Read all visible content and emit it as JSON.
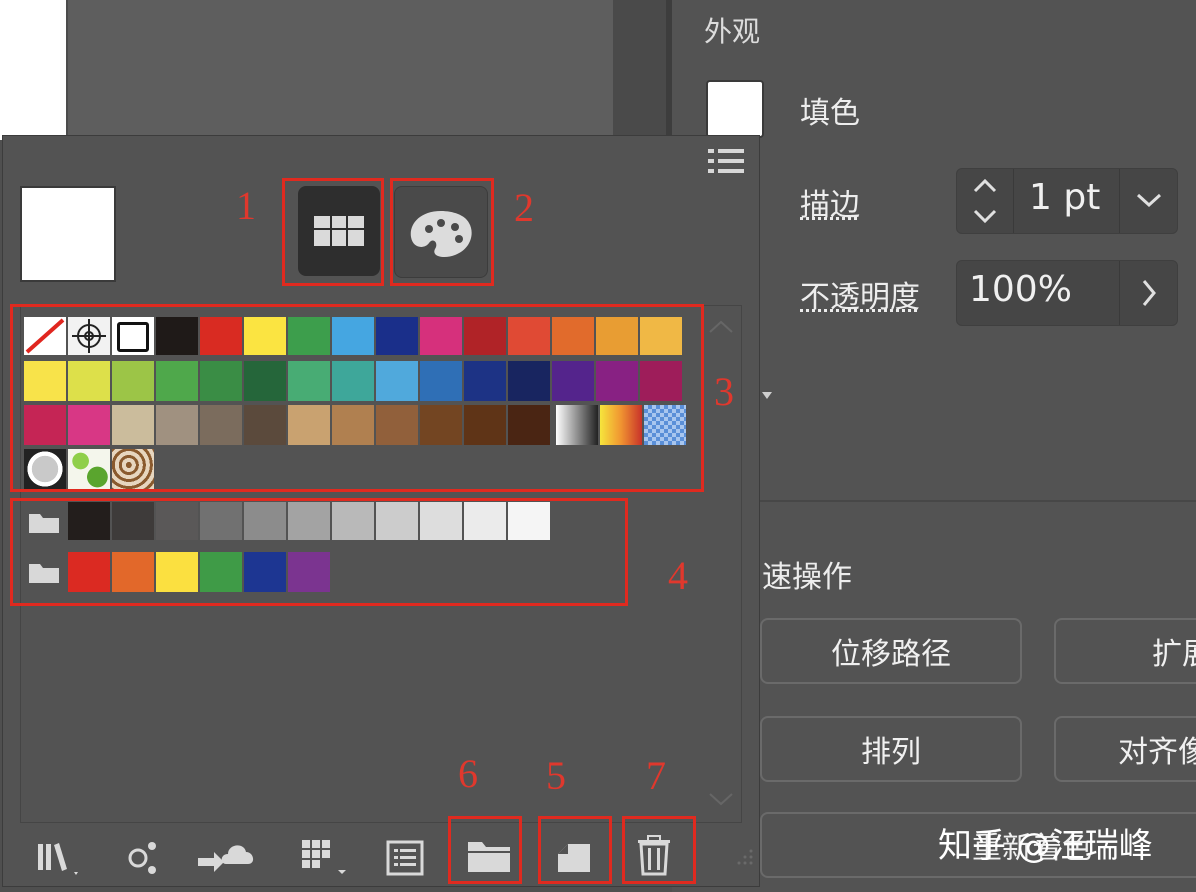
{
  "appearance_panel": {
    "title": "外观",
    "fill_label": "填色",
    "stroke_label": "描边",
    "stroke_value": "1 pt",
    "opacity_label": "不透明度",
    "opacity_value": "100%"
  },
  "quick_actions": {
    "title": "快速操作",
    "title_visible": "速操作",
    "offset_path": "位移路径",
    "expand": "扩展",
    "arrange": "排列",
    "align": "对齐像",
    "recolor": "重新着色"
  },
  "annotations": [
    "1",
    "2",
    "3",
    "4",
    "5",
    "6",
    "7"
  ],
  "watermark": "知乎 @汪瑞峰",
  "swatch_colors": {
    "row1": [
      "#1f1a18",
      "#d92b22",
      "#fbe441",
      "#3d9e4c",
      "#45a6e1",
      "#1a2f8a",
      "#d6307c",
      "#b02327",
      "#e04a34",
      "#e16b2c",
      "#e89d33",
      "#f0b845"
    ],
    "row2": [
      "#f8e34a",
      "#dde04a",
      "#9cc547",
      "#4fa84b",
      "#3a8d45",
      "#25663a",
      "#48ac74",
      "#3ea79a",
      "#50a9dc",
      "#2f6fb6",
      "#1d3385",
      "#182560",
      "#54248c",
      "#882183",
      "#9e1d5a"
    ],
    "row3": [
      "#c52555",
      "#d83785",
      "#cbbc9c",
      "#a09180",
      "#7b6c5d",
      "#5b4a3c",
      "#c9a270",
      "#b08050",
      "#91603b",
      "#734522",
      "#5f3417",
      "#4a2513"
    ],
    "grays": [
      "#231e1c",
      "#3e3b3a",
      "#5a5858",
      "#717171",
      "#8c8c8c",
      "#a3a3a3",
      "#b9b9b9",
      "#cccccc",
      "#dddddd",
      "#ebebeb",
      "#f5f5f5"
    ],
    "brights": [
      "#db2a22",
      "#e2682a",
      "#fbe040",
      "#3f9b47",
      "#1d3692",
      "#7b3490"
    ]
  },
  "icons": [
    "list-menu-icon",
    "swatch-grid-icon",
    "palette-icon",
    "libraries-icon",
    "swatch-options-icon",
    "cloud-icon",
    "grid-icon",
    "list-icon",
    "folder-icon",
    "new-swatch-icon",
    "trash-icon"
  ]
}
